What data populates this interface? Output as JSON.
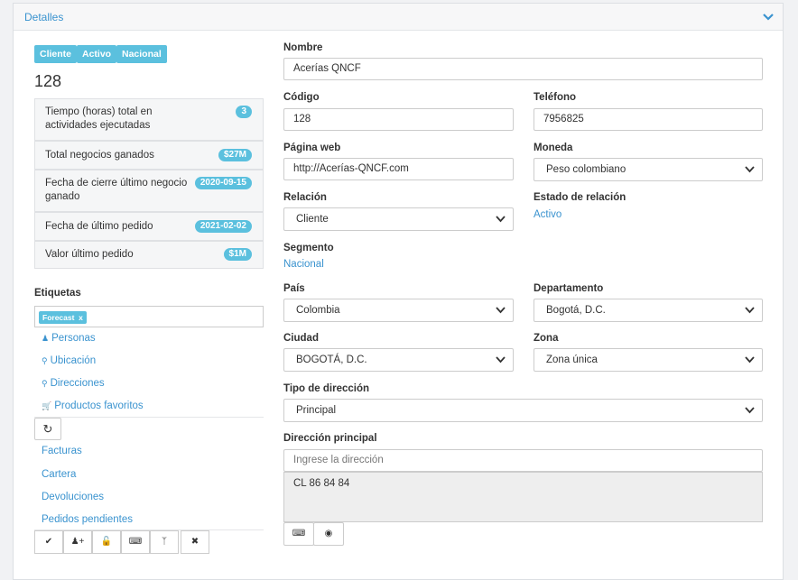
{
  "panel": {
    "title": "Detalles"
  },
  "badges": [
    "Cliente",
    "Activo",
    "Nacional"
  ],
  "client_id": "128",
  "stats": [
    {
      "label": "Tiempo (horas) total en actividades ejecutadas",
      "value": "3"
    },
    {
      "label": "Total negocios ganados",
      "value": "$27M"
    },
    {
      "label": "Fecha de cierre último negocio ganado",
      "value": "2020-09-15"
    },
    {
      "label": "Fecha de último pedido",
      "value": "2021-02-02"
    },
    {
      "label": "Valor último pedido",
      "value": "$1M"
    }
  ],
  "tags": {
    "label": "Etiquetas",
    "chips": [
      "Forecast"
    ],
    "chip_remove": "x"
  },
  "links_top": [
    "Personas",
    "Ubicación",
    "Direcciones",
    "Productos favoritos"
  ],
  "links_bottom": [
    "Facturas",
    "Cartera",
    "Devoluciones",
    "Pedidos pendientes"
  ],
  "form": {
    "nombre": {
      "label": "Nombre",
      "value": "Acerías QNCF"
    },
    "codigo": {
      "label": "Código",
      "value": "128"
    },
    "telefono": {
      "label": "Teléfono",
      "value": "7956825"
    },
    "pagina_web": {
      "label": "Página web",
      "value": "http://Acerías-QNCF.com"
    },
    "moneda": {
      "label": "Moneda",
      "value": "Peso colombiano"
    },
    "relacion": {
      "label": "Relación",
      "value": "Cliente"
    },
    "estado_relacion": {
      "label": "Estado de relación",
      "value": "Activo"
    },
    "segmento": {
      "label": "Segmento",
      "value": "Nacional"
    },
    "pais": {
      "label": "País",
      "value": "Colombia"
    },
    "departamento": {
      "label": "Departamento",
      "value": "Bogotá, D.C."
    },
    "ciudad": {
      "label": "Ciudad",
      "value": "BOGOTÁ, D.C."
    },
    "zona": {
      "label": "Zona",
      "value": "Zona única"
    },
    "tipo_direccion": {
      "label": "Tipo de dirección",
      "value": "Principal"
    },
    "direccion_principal": {
      "label": "Dirección principal",
      "placeholder": "Ingrese la dirección",
      "value": "CL  86 84 84"
    }
  },
  "colors": {
    "accent": "#3a93cf",
    "badge": "#5bc0de"
  },
  "icons": [
    "chevron-down-icon",
    "user-icon",
    "map-marker-icon",
    "cart-icon",
    "refresh-icon",
    "check-icon",
    "add-user-icon",
    "unlock-icon",
    "keyboard-icon",
    "fork-icon",
    "close-icon",
    "record-icon"
  ]
}
